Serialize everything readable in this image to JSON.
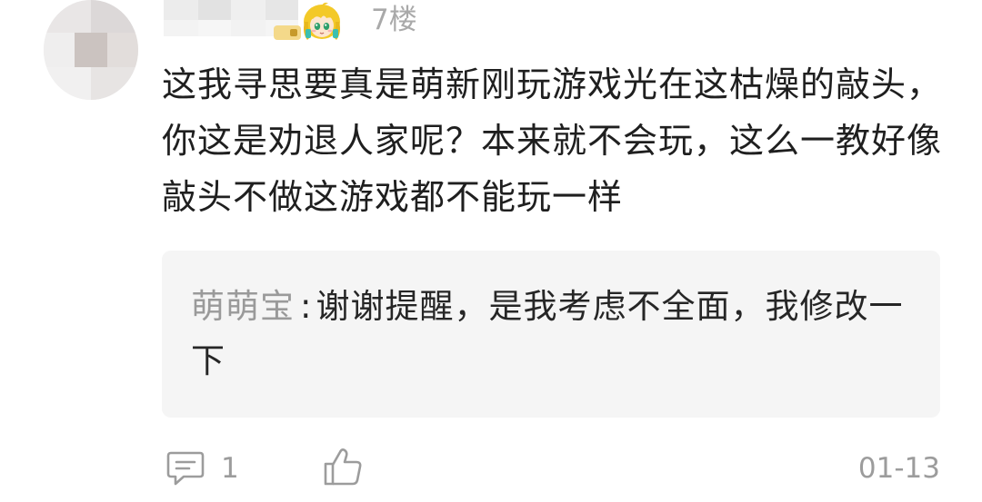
{
  "post": {
    "floor": "7楼",
    "comment_text": "这我寻思要真是萌新刚玩游戏光在这枯燥的敲头，你这是劝退人家呢？本来就不会玩，这么一教好像敲头不做这游戏都不能玩一样"
  },
  "reply": {
    "author": "萌萌宝",
    "separator": ":",
    "text": "谢谢提醒，是我考虑不全面，我修改一下"
  },
  "footer": {
    "reply_count": "1",
    "date": "01-13",
    "icons": {
      "reply": "comment-icon",
      "like": "thumbs-up-icon"
    }
  },
  "colors": {
    "text": "#1f1f1f",
    "muted": "#9c9c9c",
    "reply_bg": "#f5f5f5",
    "reply_author": "#9a9a9a"
  }
}
